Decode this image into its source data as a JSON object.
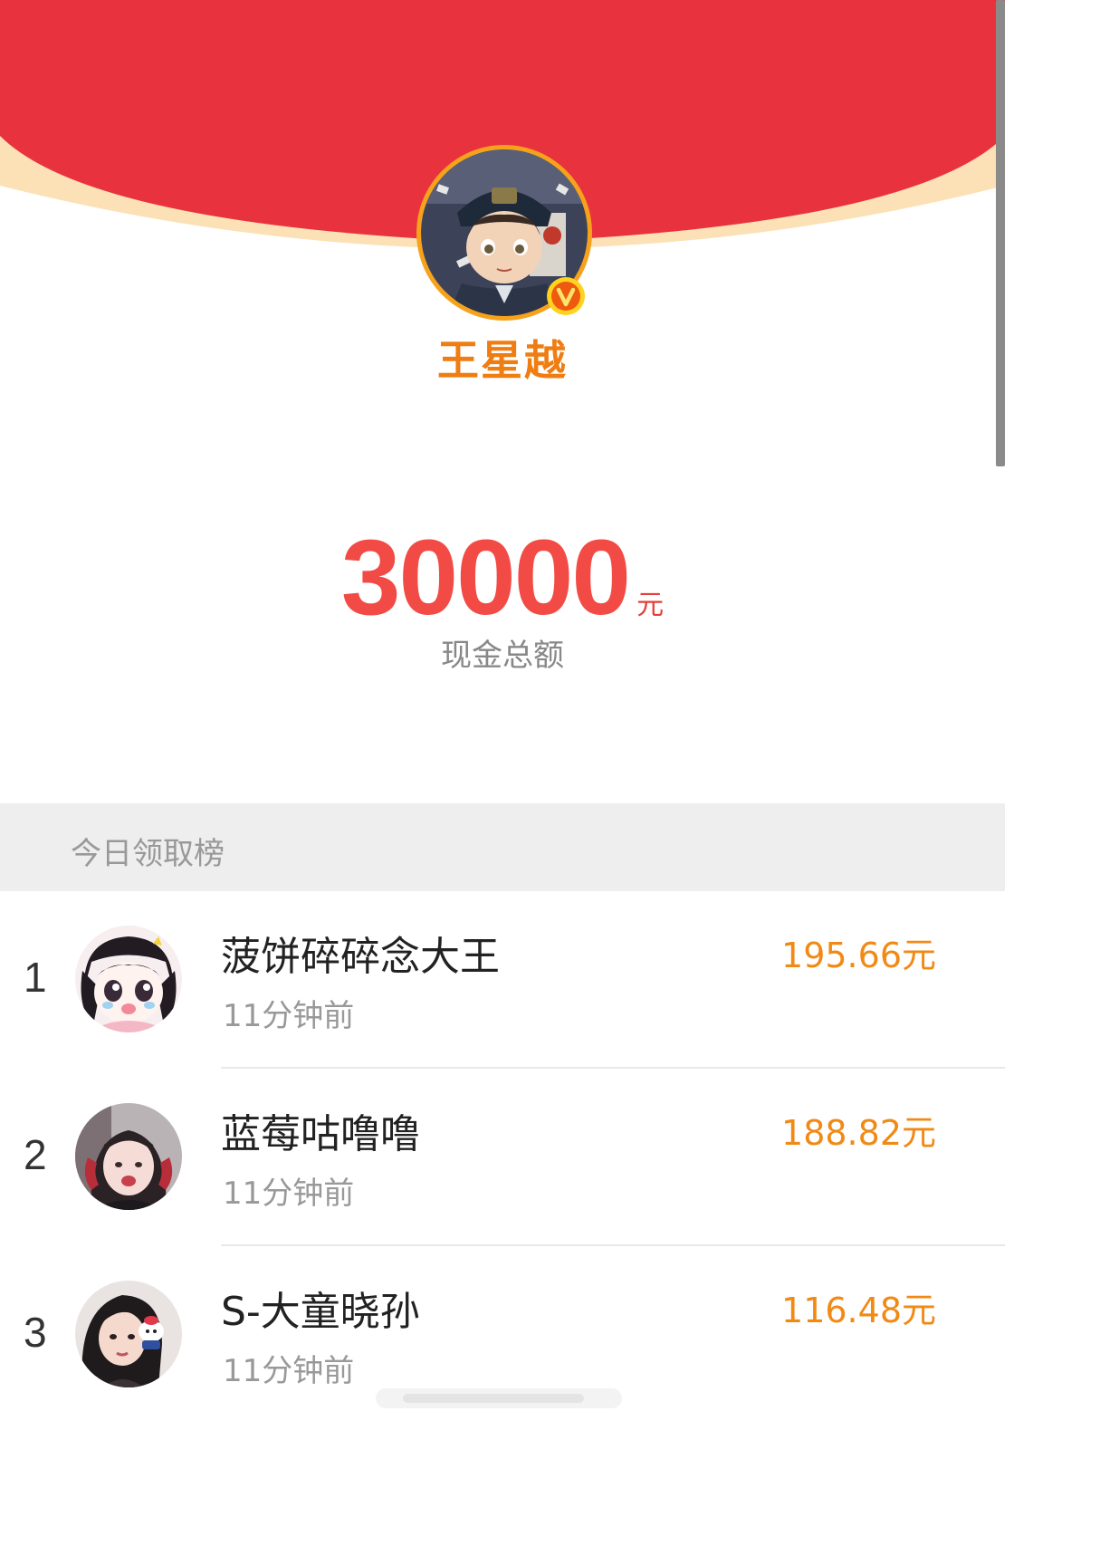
{
  "colors": {
    "header_red": "#e8323d",
    "header_cream": "#fbe1b5",
    "accent_orange": "#f18a15",
    "amount_red": "#f24b45"
  },
  "profile": {
    "name": "王星越",
    "badge_icon": "vip-v-badge-icon"
  },
  "total": {
    "amount": "30000",
    "unit": "元",
    "label": "现金总额"
  },
  "board": {
    "title": "今日领取榜",
    "rows": [
      {
        "rank": "1",
        "name": "菠饼碎碎念大王",
        "time": "11分钟前",
        "amount": "195.66元"
      },
      {
        "rank": "2",
        "name": "蓝莓咕噜噜",
        "time": "11分钟前",
        "amount": "188.82元"
      },
      {
        "rank": "3",
        "name": "S-大童晓孙",
        "time": "11分钟前",
        "amount": "116.48元"
      }
    ]
  }
}
